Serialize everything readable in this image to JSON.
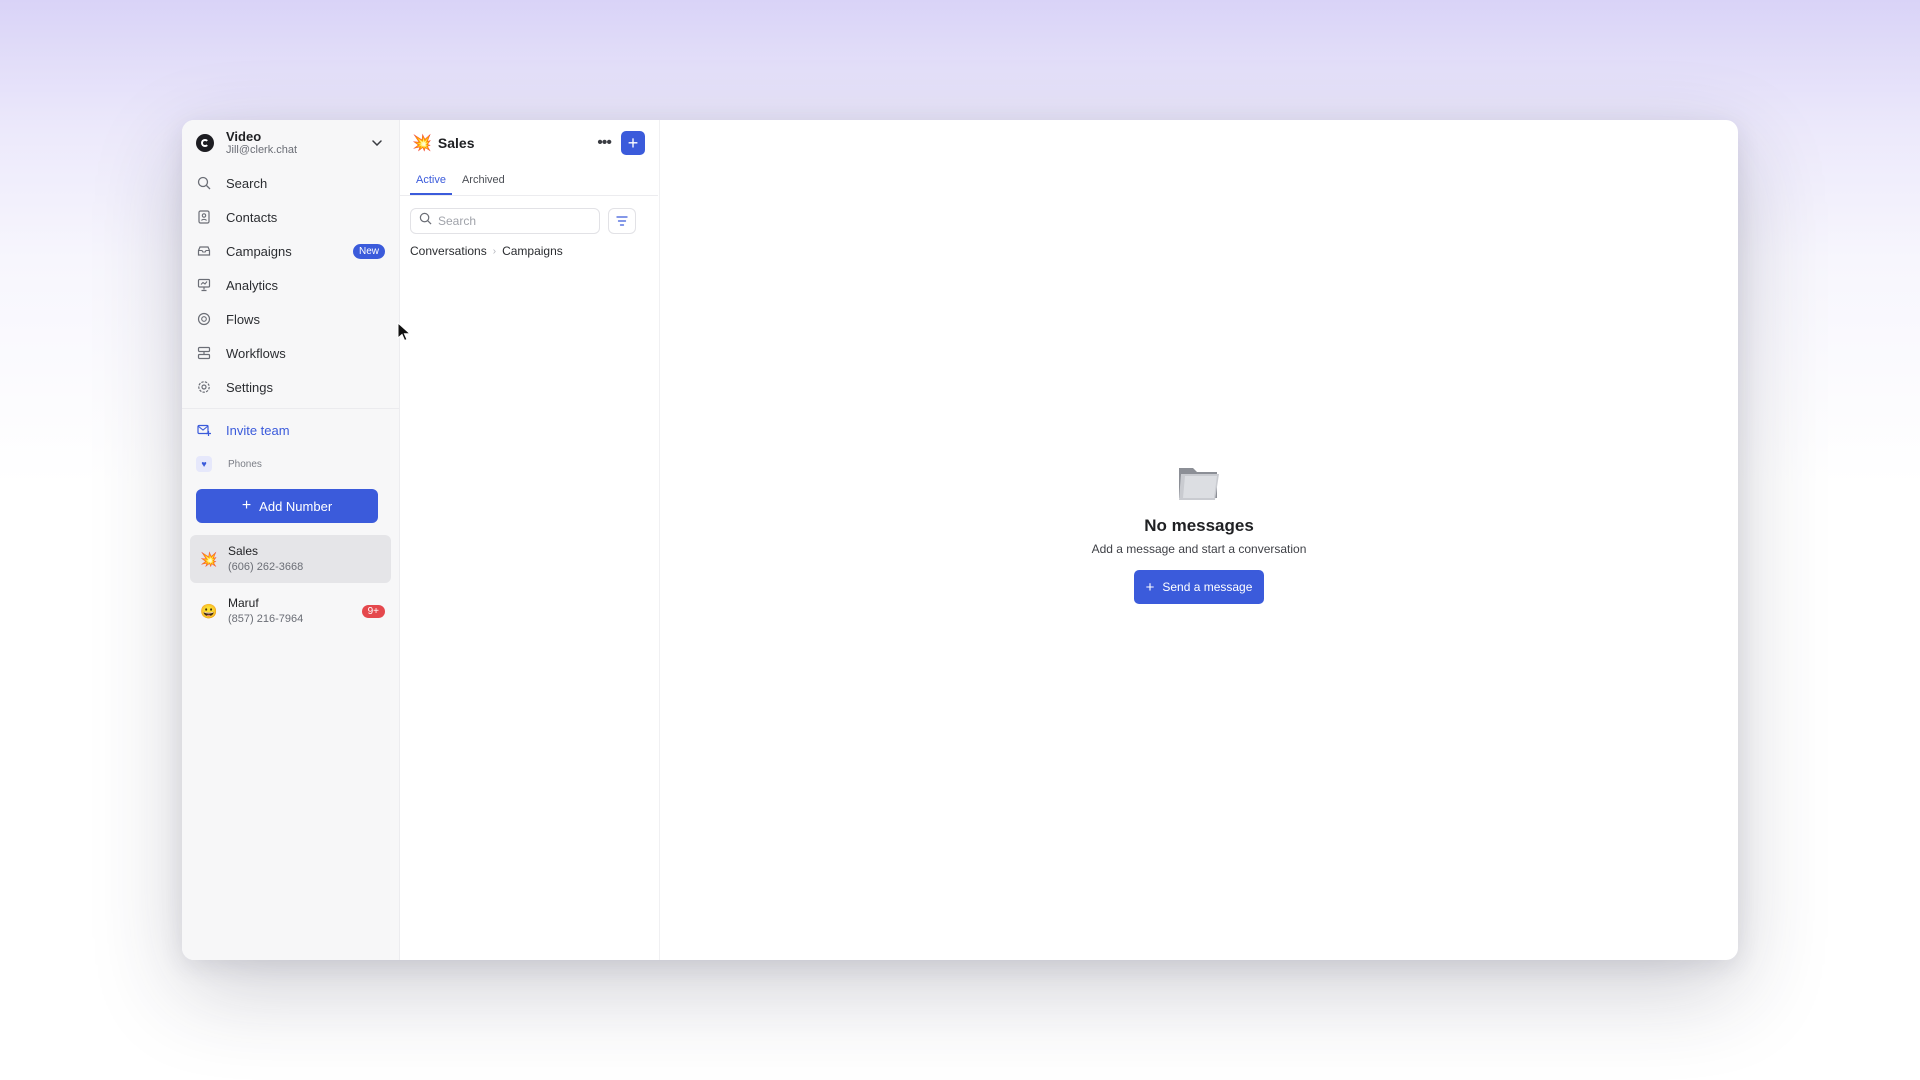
{
  "workspace": {
    "name": "Video",
    "email": "Jill@clerk.chat"
  },
  "sidebar": {
    "nav": [
      {
        "label": "Search",
        "icon": "search-icon"
      },
      {
        "label": "Contacts",
        "icon": "contacts-icon"
      },
      {
        "label": "Campaigns",
        "icon": "campaigns-icon",
        "badge": "New"
      },
      {
        "label": "Analytics",
        "icon": "analytics-icon"
      },
      {
        "label": "Flows",
        "icon": "flows-icon"
      },
      {
        "label": "Workflows",
        "icon": "workflows-icon"
      },
      {
        "label": "Settings",
        "icon": "settings-icon"
      }
    ],
    "invite_label": "Invite team",
    "phones_label": "Phones",
    "add_number_label": "Add Number",
    "phones": [
      {
        "emoji": "💥",
        "name": "Sales",
        "number": "(606) 262-3668",
        "active": true
      },
      {
        "emoji": "😀",
        "name": "Maruf",
        "number": "(857) 216-7964",
        "badge": "9+"
      }
    ]
  },
  "list_panel": {
    "emoji": "💥",
    "title": "Sales",
    "tabs": [
      "Active",
      "Archived"
    ],
    "active_tab": "Active",
    "search_placeholder": "Search",
    "breadcrumb": [
      "Conversations",
      "Campaigns"
    ]
  },
  "main": {
    "empty_title": "No messages",
    "empty_subtitle": "Add a message and start a conversation",
    "send_button_label": "Send a message"
  },
  "colors": {
    "accent": "#3b5bdb",
    "badge_red": "#e5484d",
    "sidebar_bg": "#f7f7f8"
  }
}
